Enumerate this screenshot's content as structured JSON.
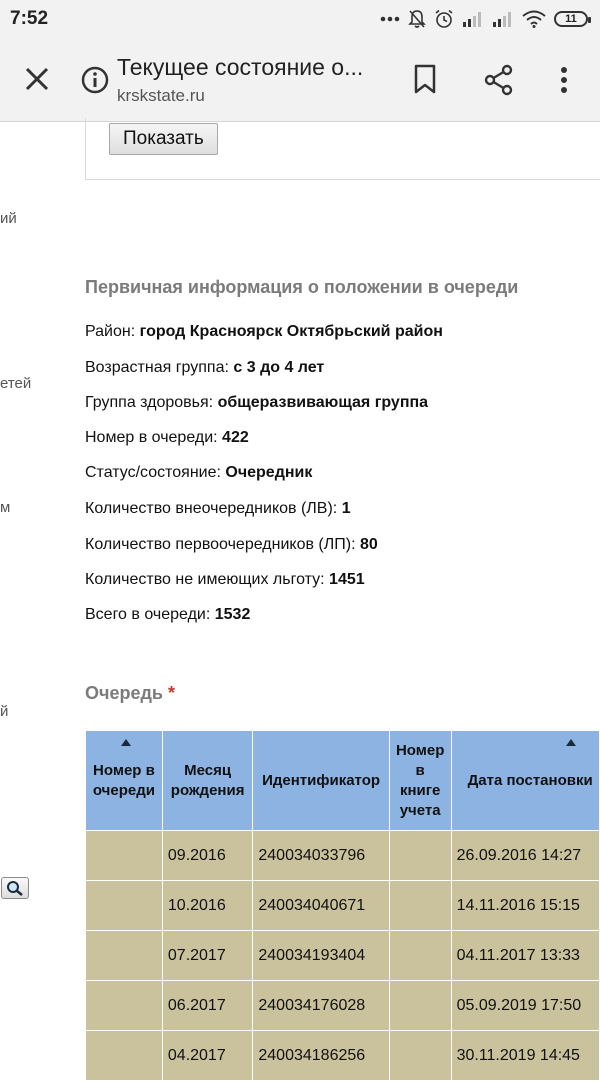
{
  "status_bar": {
    "time": "7:52",
    "battery": "11"
  },
  "browser": {
    "title": "Текущее состояние о...",
    "url": "krskstate.ru"
  },
  "sidebar_fragments": [
    "ий",
    "етей",
    "м",
    "й"
  ],
  "form": {
    "show_button": "Показать"
  },
  "info": {
    "heading": "Первичная информация о положении в очереди",
    "rows": [
      {
        "label": "Район:",
        "value": "город Красноярск Октябрьский район"
      },
      {
        "label": "Возрастная группа:",
        "value": "с 3 до 4 лет"
      },
      {
        "label": "Группа здоровья:",
        "value": "общеразвивающая группа"
      },
      {
        "label": "Номер в очереди:",
        "value": "422"
      },
      {
        "label": "Статус/состояние:",
        "value": "Очередник"
      },
      {
        "label": "Количество внеочередников (ЛВ):",
        "value": "1"
      },
      {
        "label": "Количество первоочередников (ЛП):",
        "value": "80"
      },
      {
        "label": "Количество не имеющих льготу:",
        "value": "1451"
      },
      {
        "label": "Всего в очереди:",
        "value": "1532"
      }
    ]
  },
  "queue": {
    "heading": "Очередь",
    "required_mark": "*",
    "columns": [
      "Номер в очереди",
      "Месяц рождения",
      "Идентификатор",
      "Номер в книге учета",
      "Дата постановки"
    ],
    "rows": [
      {
        "number": "",
        "month": "09.2016",
        "id": "240034033796",
        "book": "",
        "date": "26.09.2016 14:27"
      },
      {
        "number": "",
        "month": "10.2016",
        "id": "240034040671",
        "book": "",
        "date": "14.11.2016 15:15"
      },
      {
        "number": "",
        "month": "07.2017",
        "id": "240034193404",
        "book": "",
        "date": "04.11.2017 13:33"
      },
      {
        "number": "",
        "month": "06.2017",
        "id": "240034176028",
        "book": "",
        "date": "05.09.2019 17:50"
      },
      {
        "number": "",
        "month": "04.2017",
        "id": "240034186256",
        "book": "",
        "date": "30.11.2019 14:45"
      }
    ]
  },
  "colors": {
    "header_bg": "#8db3e2",
    "row_bg": "#c9c29c",
    "heading_gray": "#7b7b7b",
    "required_red": "#c0392b"
  }
}
